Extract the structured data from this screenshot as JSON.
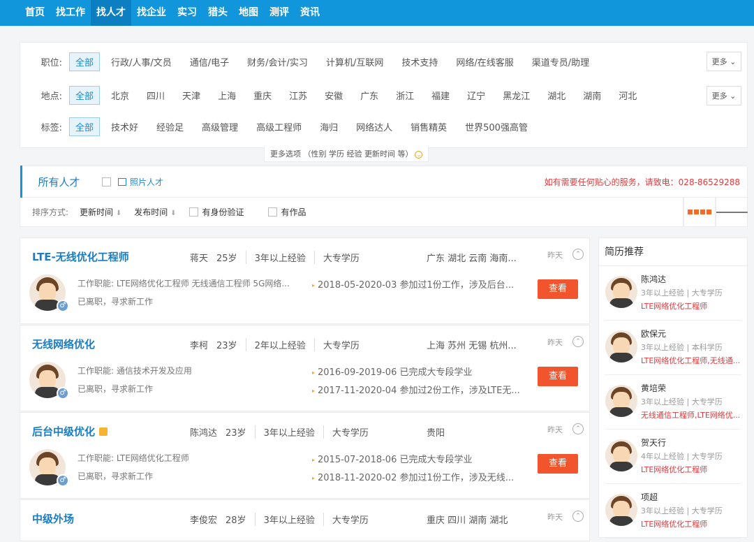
{
  "nav": [
    "首页",
    "找工作",
    "找人才",
    "找企业",
    "实习",
    "猎头",
    "地图",
    "测评",
    "资讯"
  ],
  "nav_active_index": 2,
  "filters": {
    "position": {
      "label": "职位:",
      "options": [
        "全部",
        "行政/人事/文员",
        "通信/电子",
        "财务/会计/实习",
        "计算机/互联网",
        "技术支持",
        "网络/在线客服",
        "渠道专员/助理"
      ],
      "more": "更多"
    },
    "location": {
      "label": "地点:",
      "options": [
        "全部",
        "北京",
        "四川",
        "天津",
        "上海",
        "重庆",
        "江苏",
        "安徽",
        "广东",
        "浙江",
        "福建",
        "辽宁",
        "黑龙江",
        "湖北",
        "湖南",
        "河北"
      ],
      "more": "更多"
    },
    "tags": {
      "label": "标签:",
      "options": [
        "全部",
        "技术好",
        "经验足",
        "高级管理",
        "高级工程师",
        "海归",
        "网络达人",
        "销售精英",
        "世界500强高管"
      ]
    }
  },
  "more_options": "更多选项 （性别 学历 经验 更新时间 等）",
  "tabs": {
    "all": "所有人才",
    "photo": "照片人才"
  },
  "hotline": "如有需要任何贴心的服务，请致电：028-86529288",
  "sort": {
    "label": "排序方式:",
    "update": "更新时间",
    "publish": "发布时间",
    "id_verified": "有身份验证",
    "has_works": "有作品"
  },
  "cards": [
    {
      "title": "LTE-无线优化工程师",
      "vip": false,
      "name": "蒋天",
      "age": "25岁",
      "exp": "3年以上经验",
      "edu": "大专学历",
      "loc": "广东 湖北 云南 海南...",
      "date": "昨天",
      "duty": "工作职能:  LTE网络优化工程师 无线通信工程师 5G网络...",
      "status": "已离职，寻求新工作",
      "history": [
        "2018-05-2020-03 参加过1份工作，涉及后台..."
      ],
      "btn": "查看"
    },
    {
      "title": "无线网络优化",
      "vip": false,
      "name": "李柯",
      "age": "23岁",
      "exp": "2年以上经验",
      "edu": "大专学历",
      "loc": "上海 苏州 无锡 杭州...",
      "date": "昨天",
      "duty": "工作职能:  通信技术开发及应用",
      "status": "已离职，寻求新工作",
      "history": [
        "2016-09-2019-06 已完成大专段学业",
        "2017-11-2020-04 参加过2份工作，涉及LTE无..."
      ],
      "btn": "查看"
    },
    {
      "title": "后台中级优化",
      "vip": true,
      "name": "陈鸿达",
      "age": "23岁",
      "exp": "3年以上经验",
      "edu": "大专学历",
      "loc": "贵阳",
      "date": "昨天",
      "duty": "工作职能:  LTE网络优化工程师",
      "status": "已离职，寻求新工作",
      "history": [
        "2015-07-2018-06 已完成大专段学业",
        "2018-11-2020-02 参加过1份工作，涉及无线..."
      ],
      "btn": "查看"
    },
    {
      "title": "中级外场",
      "vip": false,
      "name": "李俊宏",
      "age": "28岁",
      "exp": "3年以上经验",
      "edu": "大专学历",
      "loc": "重庆 四川 湖南 湖北",
      "date": "昨天",
      "duty": "",
      "status": "",
      "history": [],
      "btn": ""
    }
  ],
  "sidebar": {
    "title": "简历推荐",
    "items": [
      {
        "name": "陈鸿达",
        "info": "3年以上经验 | 大专学历",
        "job": "LTE网络优化工程师"
      },
      {
        "name": "欧保元",
        "info": "3年以上经验 | 本科学历",
        "job": "LTE网络优化工程师,无线通..."
      },
      {
        "name": "黄培荣",
        "info": "3年以上经验 | 大专学历",
        "job": "无线通信工程师,LTE网络优..."
      },
      {
        "name": "贺天行",
        "info": "4年以上经验 | 大专学历",
        "job": "LTE网络优化工程师"
      },
      {
        "name": "项超",
        "info": "3年以上经验 | 大专学历",
        "job": "LTE网络优化工程师"
      }
    ]
  }
}
